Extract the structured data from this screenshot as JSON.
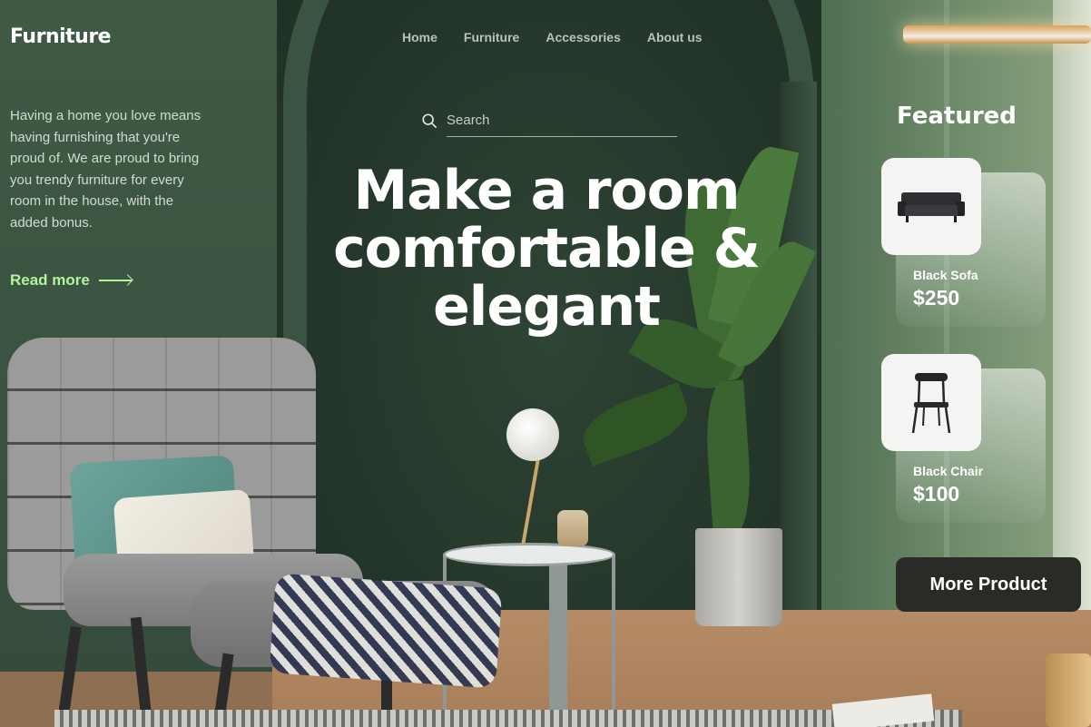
{
  "brand": {
    "logo": "Furniture"
  },
  "nav": {
    "items": [
      {
        "label": "Home"
      },
      {
        "label": "Furniture"
      },
      {
        "label": "Accessories"
      },
      {
        "label": "About us"
      }
    ]
  },
  "intro": {
    "text": "Having a home you love means having furnishing that you're proud of. We are proud to bring you trendy furniture for every room in the house, with the added bonus.",
    "read_more": "Read more"
  },
  "search": {
    "placeholder": "Search",
    "value": ""
  },
  "hero": {
    "headline": "Make a room comfortable & elegant"
  },
  "featured": {
    "title": "Featured",
    "products": [
      {
        "name": "Black Sofa",
        "price": "$250",
        "icon": "sofa-icon"
      },
      {
        "name": "Black Chair",
        "price": "$100",
        "icon": "chair-icon"
      }
    ],
    "more_button": "More Product"
  },
  "colors": {
    "accent": "#b4f2a0",
    "wall": "#34473a",
    "button": "#2a2b27"
  }
}
